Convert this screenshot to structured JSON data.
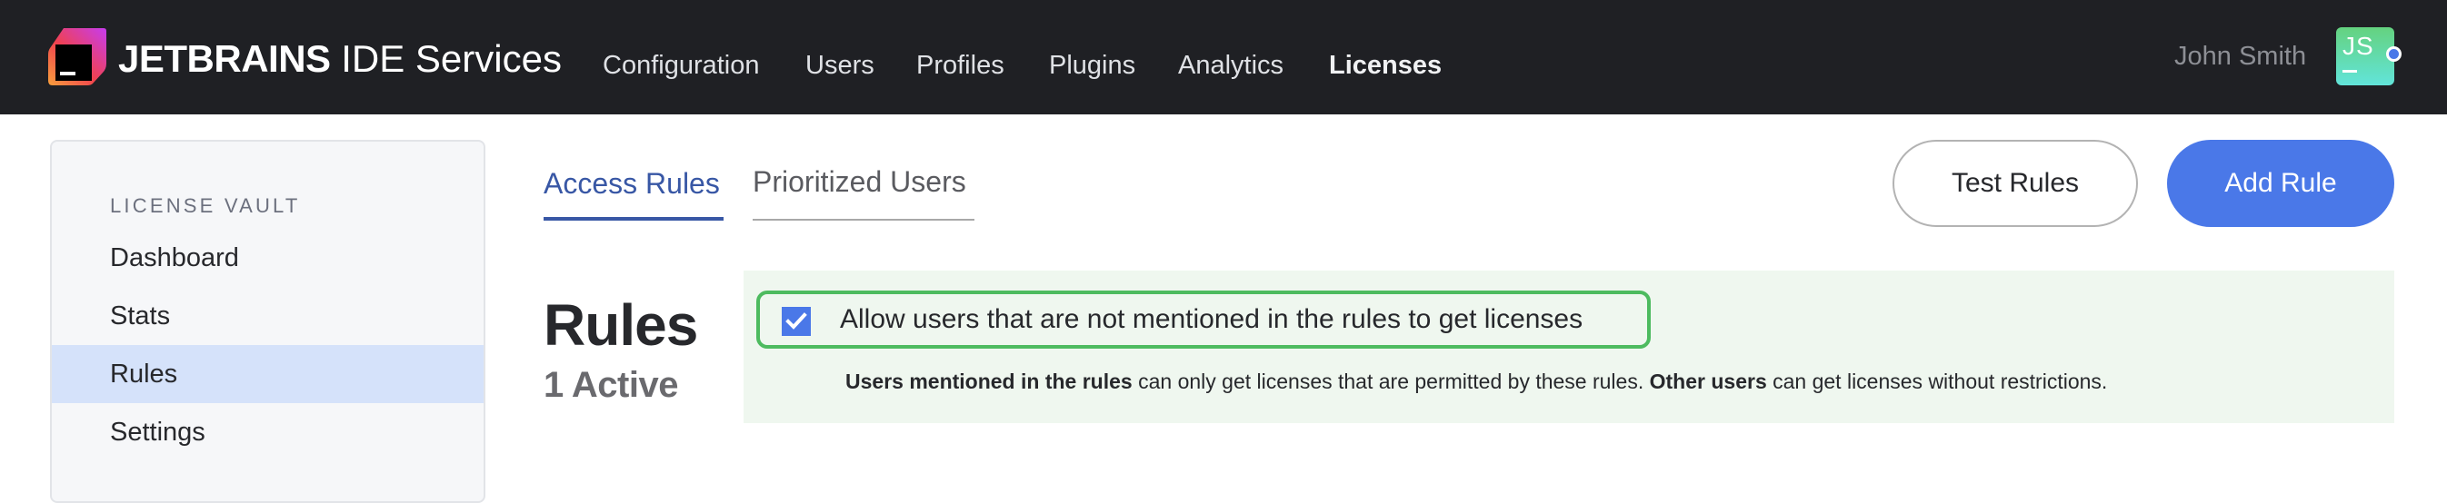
{
  "header": {
    "brand_bold": "JETBRAINS",
    "brand_light": "IDE Services",
    "logo_icon": "jetbrains-logo-icon",
    "nav": [
      {
        "label": "Configuration",
        "active": false
      },
      {
        "label": "Users",
        "active": false
      },
      {
        "label": "Profiles",
        "active": false
      },
      {
        "label": "Plugins",
        "active": false
      },
      {
        "label": "Analytics",
        "active": false
      },
      {
        "label": "Licenses",
        "active": true
      }
    ],
    "user_name": "John Smith",
    "avatar_initials": "JS",
    "status": "online"
  },
  "sidebar": {
    "heading": "LICENSE VAULT",
    "items": [
      {
        "label": "Dashboard",
        "active": false
      },
      {
        "label": "Stats",
        "active": false
      },
      {
        "label": "Rules",
        "active": true
      },
      {
        "label": "Settings",
        "active": false
      }
    ]
  },
  "tabs": [
    {
      "label": "Access Rules",
      "active": true
    },
    {
      "label": "Prioritized Users",
      "active": false
    }
  ],
  "actions": {
    "test_rules": "Test Rules",
    "add_rule": "Add Rule"
  },
  "rules": {
    "title": "Rules",
    "active_count": "1 Active"
  },
  "allow_option": {
    "checked": true,
    "label": "Allow users that are not mentioned in the rules to get licenses",
    "info_bold_1": "Users mentioned in the rules",
    "info_text_1": " can only get licenses that are permitted by these rules. ",
    "info_bold_2": "Other users",
    "info_text_2": " can get licenses without restrictions."
  },
  "colors": {
    "header_bg": "#1f2024",
    "accent_blue": "#4a78e8",
    "tab_active": "#3857a5",
    "sidebar_active": "#d5e2fa",
    "panel_bg": "#eff7ef",
    "panel_border": "#4dbb5f"
  }
}
